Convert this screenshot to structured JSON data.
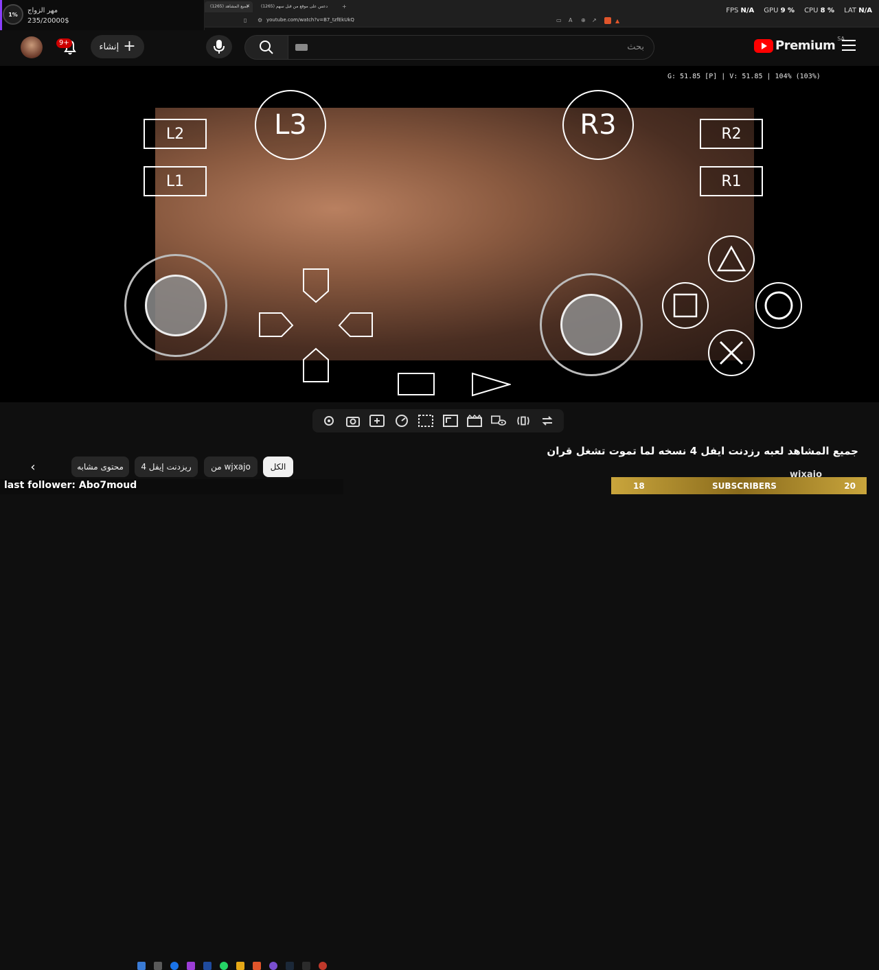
{
  "browser": {
    "tabs": [
      {
        "label": "(1265) جميع المشاهد",
        "active": true
      },
      {
        "label": "(1265) دعس على موقع من قبل سهم",
        "active": false
      }
    ],
    "url": "youtube.com/watch?v=B7_tzfEkUkQ"
  },
  "perf": {
    "fps_label": "FPS",
    "fps_value": "N/A",
    "gpu_label": "GPU",
    "gpu_value": "9 %",
    "cpu_label": "CPU",
    "cpu_value": "8 %",
    "lat_label": "LAT",
    "lat_value": "N/A"
  },
  "donation": {
    "percent": "1%",
    "title": "مهر الزواج",
    "amount": "235/20000$"
  },
  "header": {
    "notification_count": "9+",
    "create_label": "إنشاء",
    "search_placeholder": "بحث",
    "logo_word": "Premium",
    "region": "SA"
  },
  "video": {
    "stats": "G: 51.85 [P] | V: 51.85 | 104% (103%)"
  },
  "gamepad": {
    "l2": "L2",
    "l1": "L1",
    "r2": "R2",
    "r1": "R1",
    "l3": "L3",
    "r3": "R3"
  },
  "title": "جميع المشاهد لعبه رزدنت ايفل 4 نسخه لما تموت تشغل قران",
  "chips": [
    "الكل",
    "من wjxajo",
    "ريزدنت إيفل 4",
    "محتوى مشابه"
  ],
  "channel": "wjxajo",
  "overlay": {
    "last_follower": "last follower: Abo7moud",
    "subs_current": "18",
    "subs_label": "SUBSCRIBERS",
    "subs_goal": "20"
  },
  "colors": {
    "accent_red": "#ff0000",
    "badge_red": "#cc0000",
    "subs_gold": "#c9a53c",
    "donation_purple": "#8a3ffc"
  }
}
